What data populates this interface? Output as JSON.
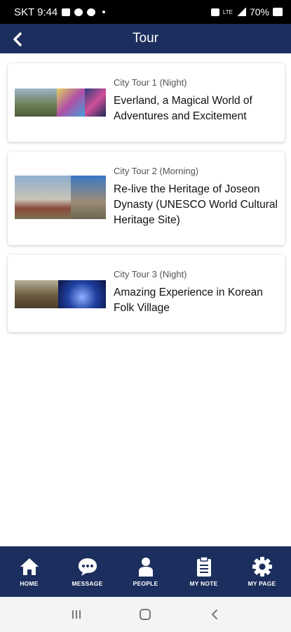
{
  "status_bar": {
    "carrier_time": "SKT 9:44",
    "lte": "LTE",
    "battery": "70%"
  },
  "header": {
    "title": "Tour",
    "back_icon": "back-arrow-icon"
  },
  "tours": [
    {
      "subtitle": "City Tour 1 (Night)",
      "title": "Everland, a Magical World of Adventures and Excitement",
      "thumb_colors": [
        "#6a7d54",
        "#b04fa8",
        "#2b3d7a"
      ]
    },
    {
      "subtitle": "City Tour 2 (Morning)",
      "title": "Re-live the Heritage of Joseon Dynasty (UNESCO World Cultural Heritage Site)",
      "thumb_colors": [
        "#7a8fa8",
        "#9b8c76"
      ]
    },
    {
      "subtitle": "City Tour 3 (Night)",
      "title": "Amazing Experience in Korean Folk Village",
      "thumb_colors": [
        "#6b5a3e",
        "#1f3fa0"
      ]
    }
  ],
  "bottom_nav": [
    {
      "label": "HOME",
      "icon": "home-icon"
    },
    {
      "label": "MESSAGE",
      "icon": "message-icon"
    },
    {
      "label": "PEOPLE",
      "icon": "person-icon"
    },
    {
      "label": "MY NOTE",
      "icon": "note-icon"
    },
    {
      "label": "MY PAGE",
      "icon": "gear-icon"
    }
  ],
  "colors": {
    "primary": "#1c2e5d",
    "background": "#ffffff"
  }
}
